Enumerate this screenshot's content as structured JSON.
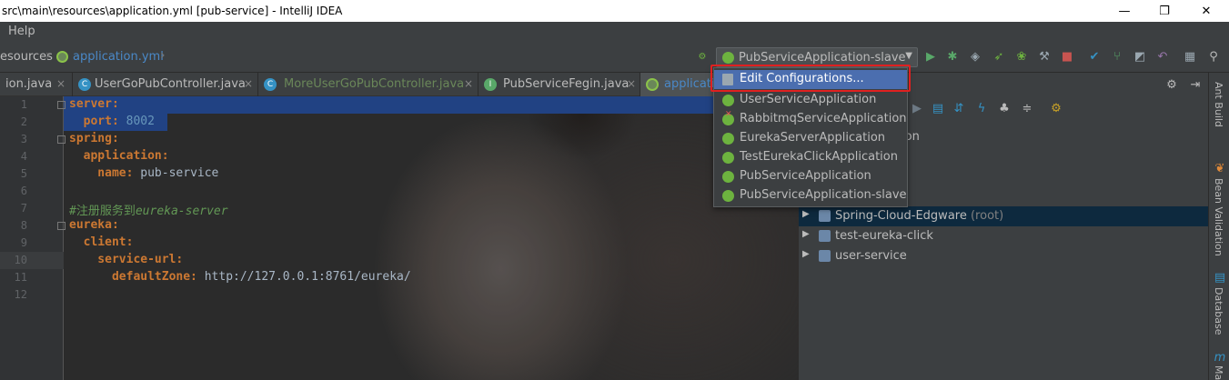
{
  "window": {
    "title": "src\\main\\resources\\application.yml [pub-service] - IntelliJ IDEA",
    "minimize": "—",
    "maximize": "❐",
    "close": "✕"
  },
  "menu": {
    "help": "Help"
  },
  "breadcrumb": {
    "folder": "esources",
    "file": "application.yml"
  },
  "run_config": {
    "selected": "PubServiceApplication-slave"
  },
  "tabs": [
    {
      "label": "ion.java",
      "icon": ""
    },
    {
      "label": "UserGoPubController.java",
      "icon": "C"
    },
    {
      "label": "MoreUserGoPubController.java",
      "icon": "C"
    },
    {
      "label": "PubServiceFegin.java",
      "icon": "I"
    },
    {
      "label": "applicati",
      "icon": ""
    }
  ],
  "code": {
    "line_numbers": [
      "1",
      "2",
      "3",
      "4",
      "5",
      "6",
      "7",
      "8",
      "9",
      "10",
      "11",
      "12"
    ],
    "l1": "server:",
    "l2_key": "  port:",
    "l2_val": " 8002",
    "l3": "spring:",
    "l4": "  application:",
    "l5_key": "    name:",
    "l5_val": " pub-service",
    "l7_hash": "#",
    "l7_cn": "注册服务到",
    "l7_en": "eureka-server",
    "l8": "eureka:",
    "l9": "  client:",
    "l10": "    service-url:",
    "l11_key": "      defaultZone:",
    "l11_val": " http://127.0.0.1:8761/eureka/"
  },
  "dropdown": {
    "edit": "Edit Configurations...",
    "items": [
      {
        "label": "UserServiceApplication",
        "error": false
      },
      {
        "label": "RabbitmqServiceApplication",
        "error": true
      },
      {
        "label": "EurekaServerApplication",
        "error": false
      },
      {
        "label": "TestEurekaClickApplication",
        "error": false
      },
      {
        "label": "PubServiceApplication",
        "error": false
      },
      {
        "label": "PubServiceApplication-slave",
        "error": false
      }
    ]
  },
  "maven_tree": {
    "partials": [
      "ation",
      "r"
    ],
    "rows": [
      {
        "label": "Spring-Cloud-Edgware",
        "suffix": "(root)"
      },
      {
        "label": "test-eureka-click",
        "suffix": ""
      },
      {
        "label": "user-service",
        "suffix": ""
      }
    ]
  },
  "side_tools": {
    "ant": "Ant Build",
    "bean": "Bean Validation",
    "database": "Database",
    "maven": "Ma"
  },
  "colors": {
    "selection": "#214283",
    "highlight": "#4b6eaf",
    "annotation": "#e02020",
    "spring": "#6db33f"
  }
}
